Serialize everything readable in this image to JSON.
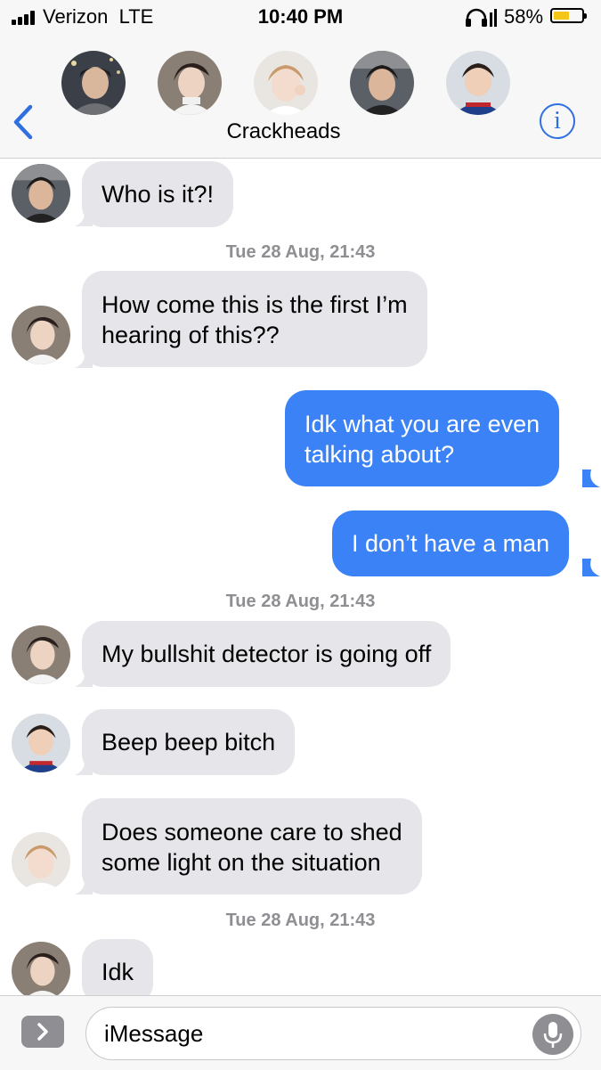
{
  "status": {
    "carrier": "Verizon",
    "network": "LTE",
    "time": "10:40 PM",
    "battery_percent": "58%",
    "battery_level": 0.58,
    "battery_color": "#f5c518"
  },
  "header": {
    "group_name": "Crackheads",
    "info_icon": "i",
    "avatars": [
      "avatar-1",
      "avatar-2",
      "avatar-3",
      "avatar-4",
      "avatar-5"
    ]
  },
  "colors": {
    "accent": "#2f6fe0",
    "outgoing_bubble": "#3b82f6",
    "incoming_bubble": "#e5e5ea",
    "timestamp": "#8e8e93"
  },
  "conversation": {
    "timestamps": [
      "Tue 28 Aug, 21:43",
      "Tue 28 Aug, 21:43",
      "Tue 28 Aug, 21:43"
    ],
    "messages": [
      {
        "direction": "incoming",
        "lines": [
          "Who is it?!"
        ]
      },
      {
        "direction": "incoming",
        "lines": [
          "How come this is the first I’m",
          "hearing of this??"
        ]
      },
      {
        "direction": "outgoing",
        "lines": [
          "Idk what you are even",
          "talking about?"
        ]
      },
      {
        "direction": "outgoing",
        "lines": [
          "I don’t have a man"
        ]
      },
      {
        "direction": "incoming",
        "lines": [
          "My bullshit detector is going off"
        ]
      },
      {
        "direction": "incoming",
        "lines": [
          "Beep beep bitch"
        ]
      },
      {
        "direction": "incoming",
        "lines": [
          "Does someone care to shed",
          "some light on the situation"
        ]
      },
      {
        "direction": "incoming",
        "lines": [
          "Idk"
        ]
      }
    ]
  },
  "input": {
    "placeholder": "iMessage",
    "apps_icon": "chevron-right-icon",
    "mic_icon": "microphone-icon"
  }
}
